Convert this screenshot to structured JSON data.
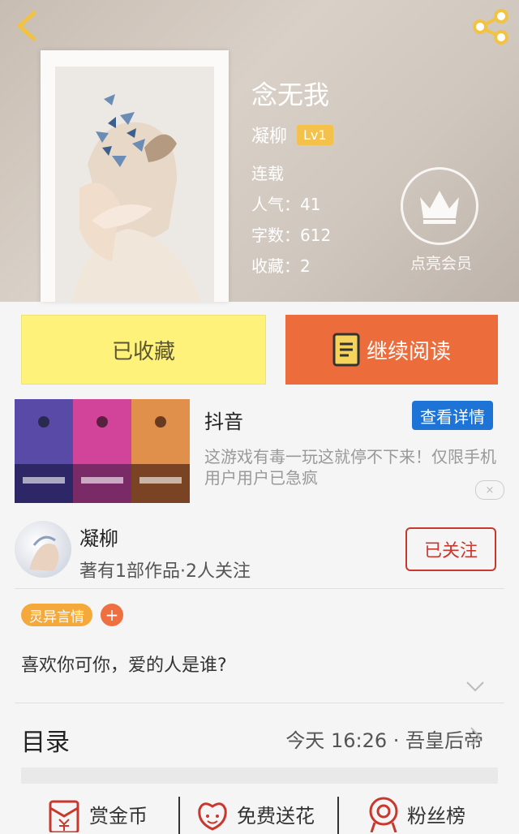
{
  "book": {
    "title": "念无我",
    "author": "凝柳",
    "level": "Lv1",
    "status": "连载",
    "popularity": "人气：41",
    "word_count": "字数：612",
    "favorites": "收藏：2"
  },
  "vip": {
    "label": "点亮会员"
  },
  "actions": {
    "collected_label": "已收藏",
    "read_label": "继续阅读"
  },
  "ad": {
    "title": "抖音",
    "details_label": "查看详情",
    "description": "这游戏有毒一玩这就停不下来！仅限手机用户用户已急疯",
    "close_label": "×"
  },
  "author_section": {
    "name": "凝柳",
    "stats": "著有1部作品·2人关注",
    "follow_label": "已关注"
  },
  "tags": [
    {
      "label": "灵异言情"
    }
  ],
  "tag_add_label": "+",
  "intro": "喜欢你可你，爱的人是谁?",
  "toc": {
    "label": "目录",
    "latest": "今天 16:26 · 吾皇后帝"
  },
  "bottom_bar": [
    {
      "label": "赏金币"
    },
    {
      "label": "免费送花"
    },
    {
      "label": "粉丝榜"
    }
  ],
  "colors": {
    "accent_orange": "#ec6c3c",
    "collected_yellow": "#fef27b",
    "follow_red": "#c8382e",
    "ad_blue": "#1e73d6"
  }
}
